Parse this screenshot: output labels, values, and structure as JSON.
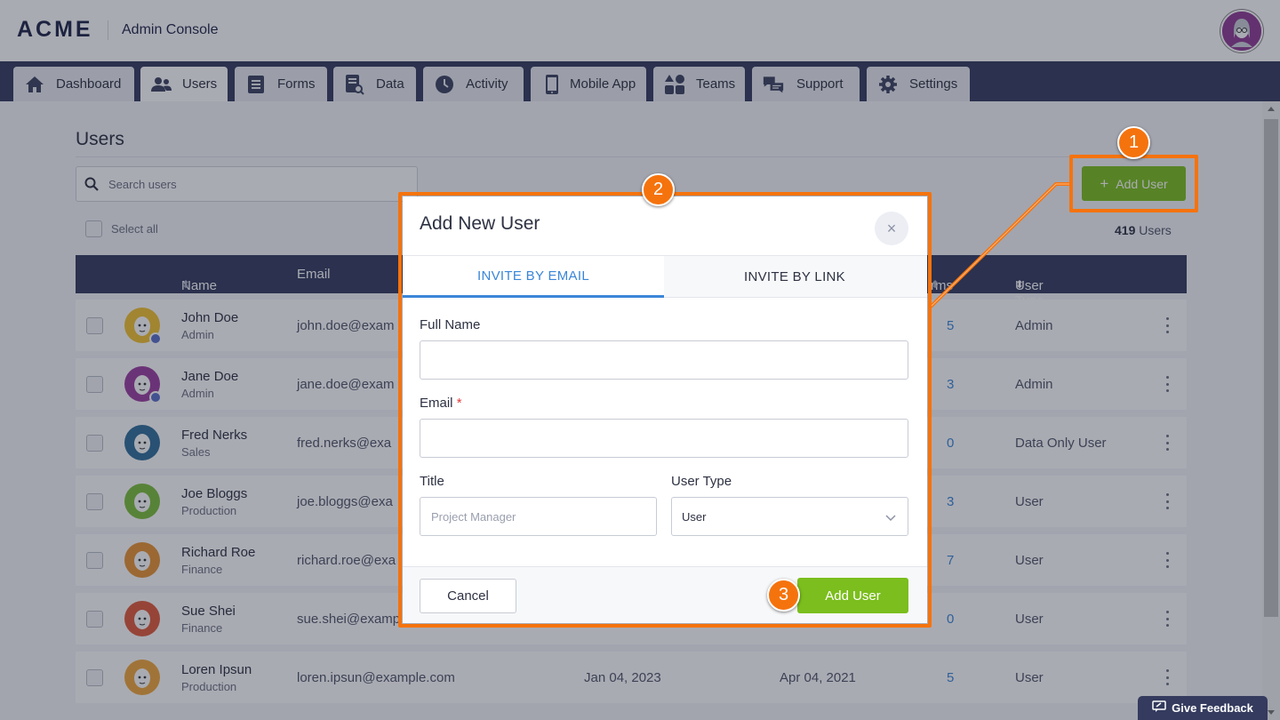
{
  "header": {
    "logo": "ACME",
    "title": "Admin Console",
    "avatar_icon": "user-avatar"
  },
  "nav": {
    "tabs": [
      {
        "label": "Dashboard",
        "icon": "home-icon"
      },
      {
        "label": "Users",
        "icon": "users-icon",
        "active": true
      },
      {
        "label": "Forms",
        "icon": "forms-icon"
      },
      {
        "label": "Data",
        "icon": "data-icon"
      },
      {
        "label": "Activity",
        "icon": "activity-icon"
      },
      {
        "label": "Mobile App",
        "icon": "mobile-icon"
      },
      {
        "label": "Teams",
        "icon": "teams-icon"
      },
      {
        "label": "Support",
        "icon": "support-icon"
      },
      {
        "label": "Settings",
        "icon": "gear-icon"
      }
    ]
  },
  "page": {
    "title": "Users",
    "search_placeholder": "Search users",
    "select_all": "Select all",
    "add_user": "Add User",
    "count_num": "419",
    "count_label": "Users"
  },
  "table": {
    "headers": {
      "name": "Name",
      "email": "Email",
      "forms": "rms",
      "user_type": "User Type"
    },
    "rows": [
      {
        "name": "John Doe",
        "role": "Admin",
        "email": "john.doe@exam",
        "date1": "",
        "date2": "",
        "forms": "5",
        "type": "Admin",
        "color": "#f2c230"
      },
      {
        "name": "Jane Doe",
        "role": "Admin",
        "email": "jane.doe@exam",
        "date1": "",
        "date2": "",
        "forms": "3",
        "type": "Admin",
        "color": "#9b3ea0"
      },
      {
        "name": "Fred Nerks",
        "role": "Sales",
        "email": "fred.nerks@exa",
        "date1": "",
        "date2": "",
        "forms": "0",
        "type": "Data Only User",
        "color": "#2f6f9a"
      },
      {
        "name": "Joe Bloggs",
        "role": "Production",
        "email": "joe.bloggs@exa",
        "date1": "",
        "date2": "",
        "forms": "3",
        "type": "User",
        "color": "#7bbe3a"
      },
      {
        "name": "Richard Roe",
        "role": "Finance",
        "email": "richard.roe@exa",
        "date1": "",
        "date2": "",
        "forms": "7",
        "type": "User",
        "color": "#e89433"
      },
      {
        "name": "Sue Shei",
        "role": "Finance",
        "email": "sue.shei@examp",
        "date1": "",
        "date2": "",
        "forms": "0",
        "type": "User",
        "color": "#e05a3a"
      },
      {
        "name": "Loren Ipsun",
        "role": "Production",
        "email": "loren.ipsun@example.com",
        "date1": "Jan 04, 2023",
        "date2": "Apr 04, 2021",
        "forms": "5",
        "type": "User",
        "color": "#f0a63a"
      }
    ]
  },
  "modal": {
    "title": "Add New User",
    "close": "×",
    "tabs": [
      "INVITE BY EMAIL",
      "INVITE BY LINK"
    ],
    "full_name_label": "Full Name",
    "full_name_value": "",
    "email_label": "Email",
    "email_required": "*",
    "email_value": "",
    "title_label": "Title",
    "title_placeholder": "Project Manager",
    "user_type_label": "User Type",
    "user_type_value": "User",
    "cancel": "Cancel",
    "submit": "Add User"
  },
  "callouts": [
    "1",
    "2",
    "3"
  ],
  "feedback": "Give Feedback",
  "colors": {
    "accent": "#f5730d",
    "primary_green": "#7bbe1d",
    "nav_bg": "#343b5e",
    "link_blue": "#3a86d8"
  }
}
